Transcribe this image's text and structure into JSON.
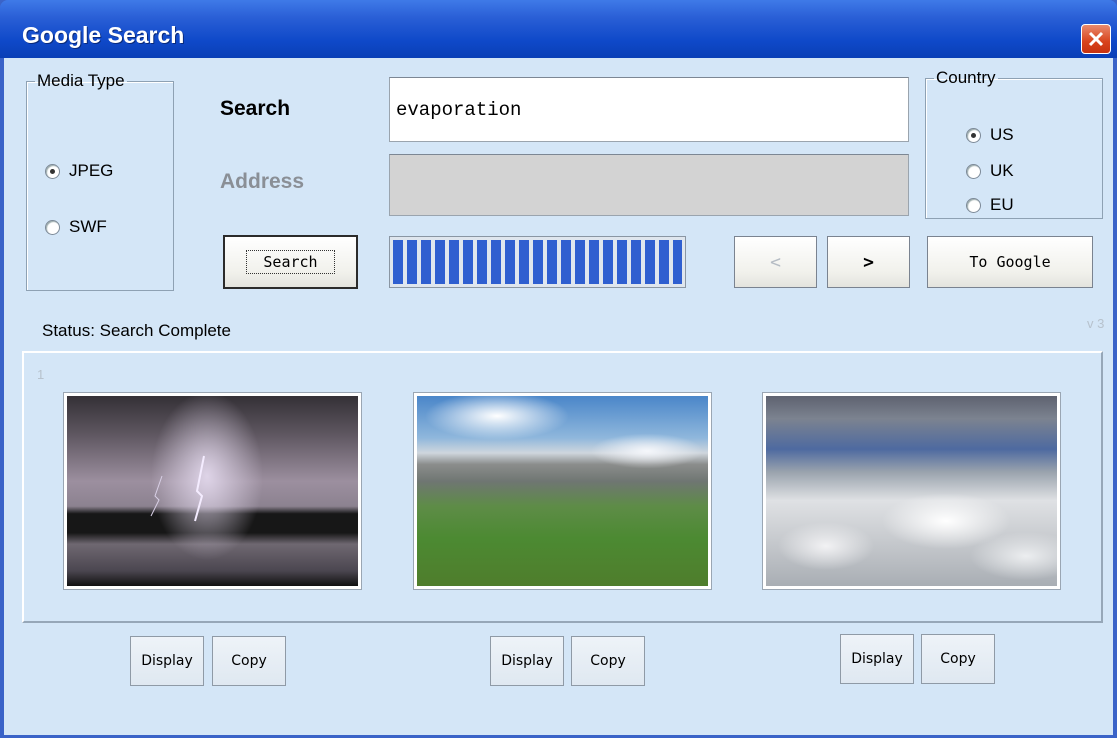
{
  "window": {
    "title": "Google Search",
    "close_icon": "close-icon"
  },
  "media_type": {
    "legend": "Media Type",
    "options": [
      {
        "label": "JPEG",
        "selected": true
      },
      {
        "label": "SWF",
        "selected": false
      }
    ]
  },
  "search": {
    "label": "Search",
    "value": "evaporation",
    "button_label": "Search"
  },
  "address": {
    "label": "Address",
    "value": "",
    "disabled": true
  },
  "country": {
    "legend": "Country",
    "options": [
      {
        "label": "US",
        "selected": true
      },
      {
        "label": "UK",
        "selected": false
      },
      {
        "label": "EU",
        "selected": false
      }
    ]
  },
  "nav": {
    "prev_label": "<",
    "next_label": ">",
    "to_google_label": "To Google"
  },
  "progress": {
    "fraction": 1.0
  },
  "status": {
    "text": "Status: Search Complete",
    "version": "v 3"
  },
  "results": {
    "page_number": "1",
    "items": [
      {
        "subject": "lightning storm",
        "display_label": "Display",
        "copy_label": "Copy"
      },
      {
        "subject": "mountain valley",
        "display_label": "Display",
        "copy_label": "Copy"
      },
      {
        "subject": "clouds from above",
        "display_label": "Display",
        "copy_label": "Copy"
      }
    ]
  },
  "colors": {
    "title_bar": "#0f49c9",
    "client_bg": "#d4e6f7",
    "progress_fill": "#2f5fd0",
    "close_button": "#d8431c"
  }
}
